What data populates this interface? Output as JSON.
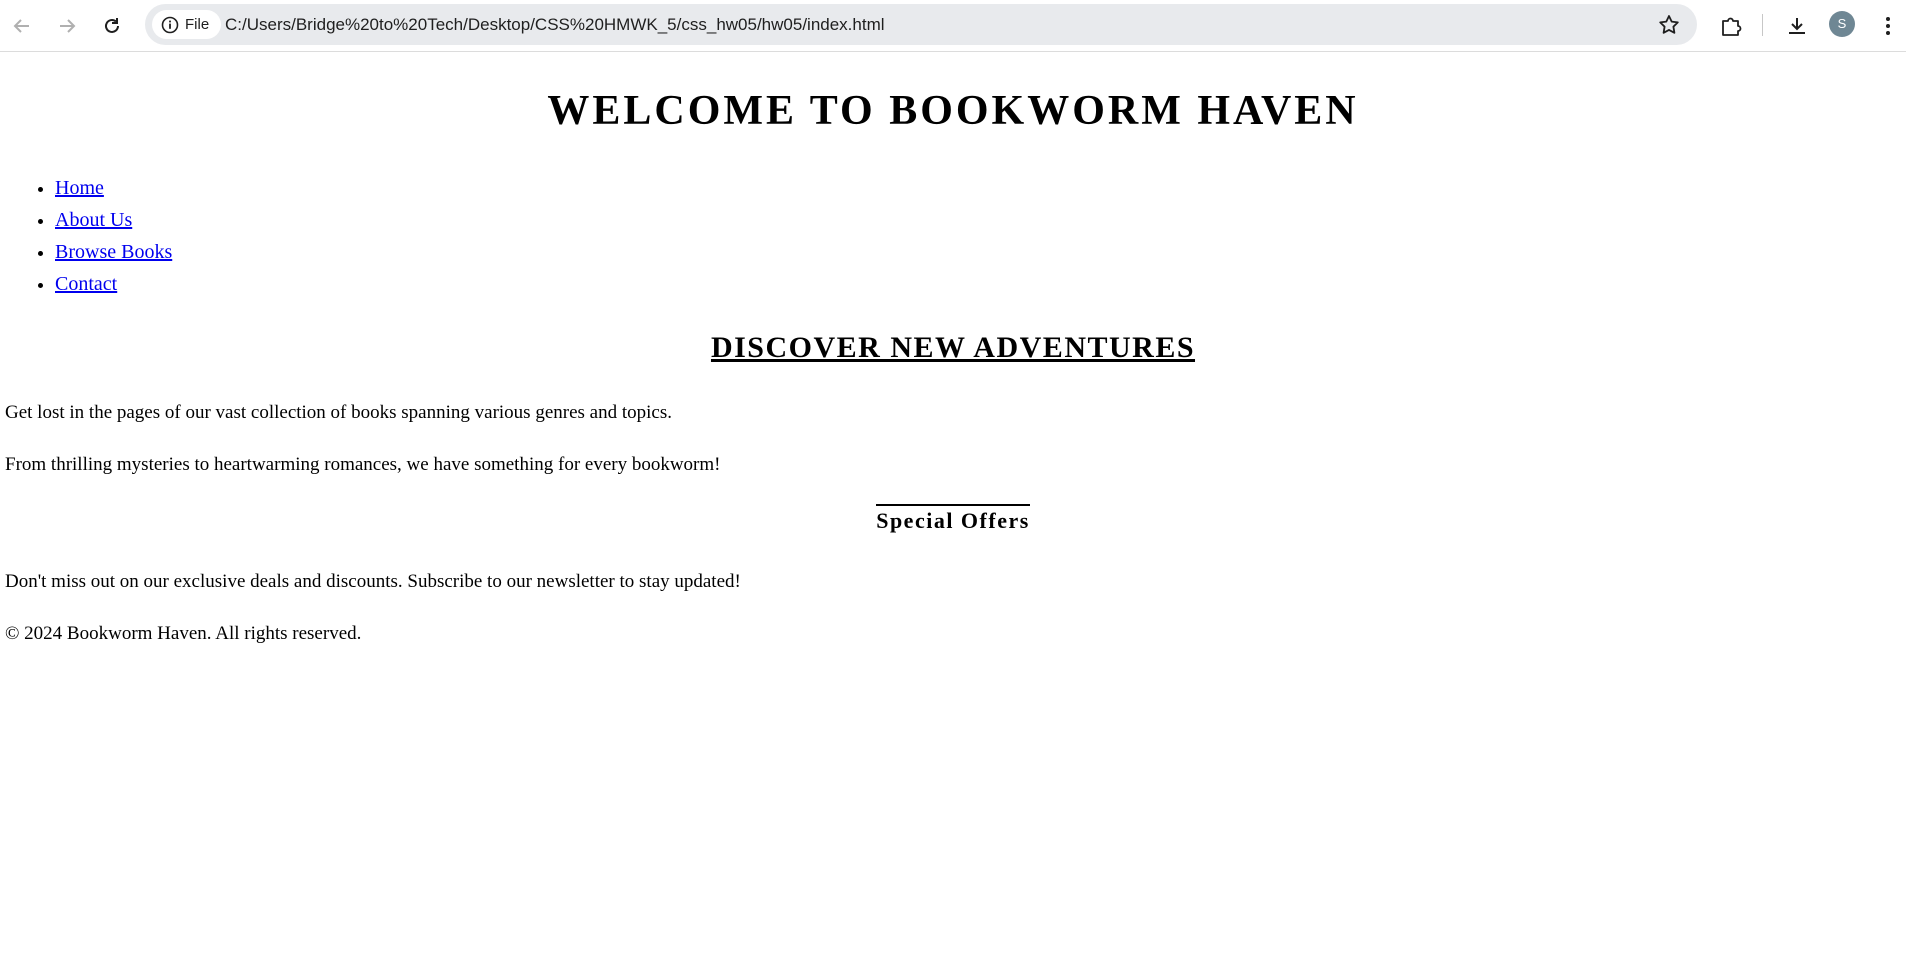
{
  "browser": {
    "chip_label": "File",
    "url": "C:/Users/Bridge%20to%20Tech/Desktop/CSS%20HMWK_5/css_hw05/hw05/index.html",
    "profile_initial": "S"
  },
  "page": {
    "title": "Welcome to Bookworm Haven",
    "nav": [
      {
        "label": "Home"
      },
      {
        "label": "About Us"
      },
      {
        "label": "Browse Books"
      },
      {
        "label": "Contact"
      }
    ],
    "section_heading": "Discover New Adventures",
    "paragraphs": [
      "Get lost in the pages of our vast collection of books spanning various genres and topics.",
      "From thrilling mysteries to heartwarming romances, we have something for every bookworm!"
    ],
    "offers_heading": "Special Offers",
    "offers_text": "Don't miss out on our exclusive deals and discounts. Subscribe to our newsletter to stay updated!",
    "footer": "© 2024 Bookworm Haven. All rights reserved."
  }
}
